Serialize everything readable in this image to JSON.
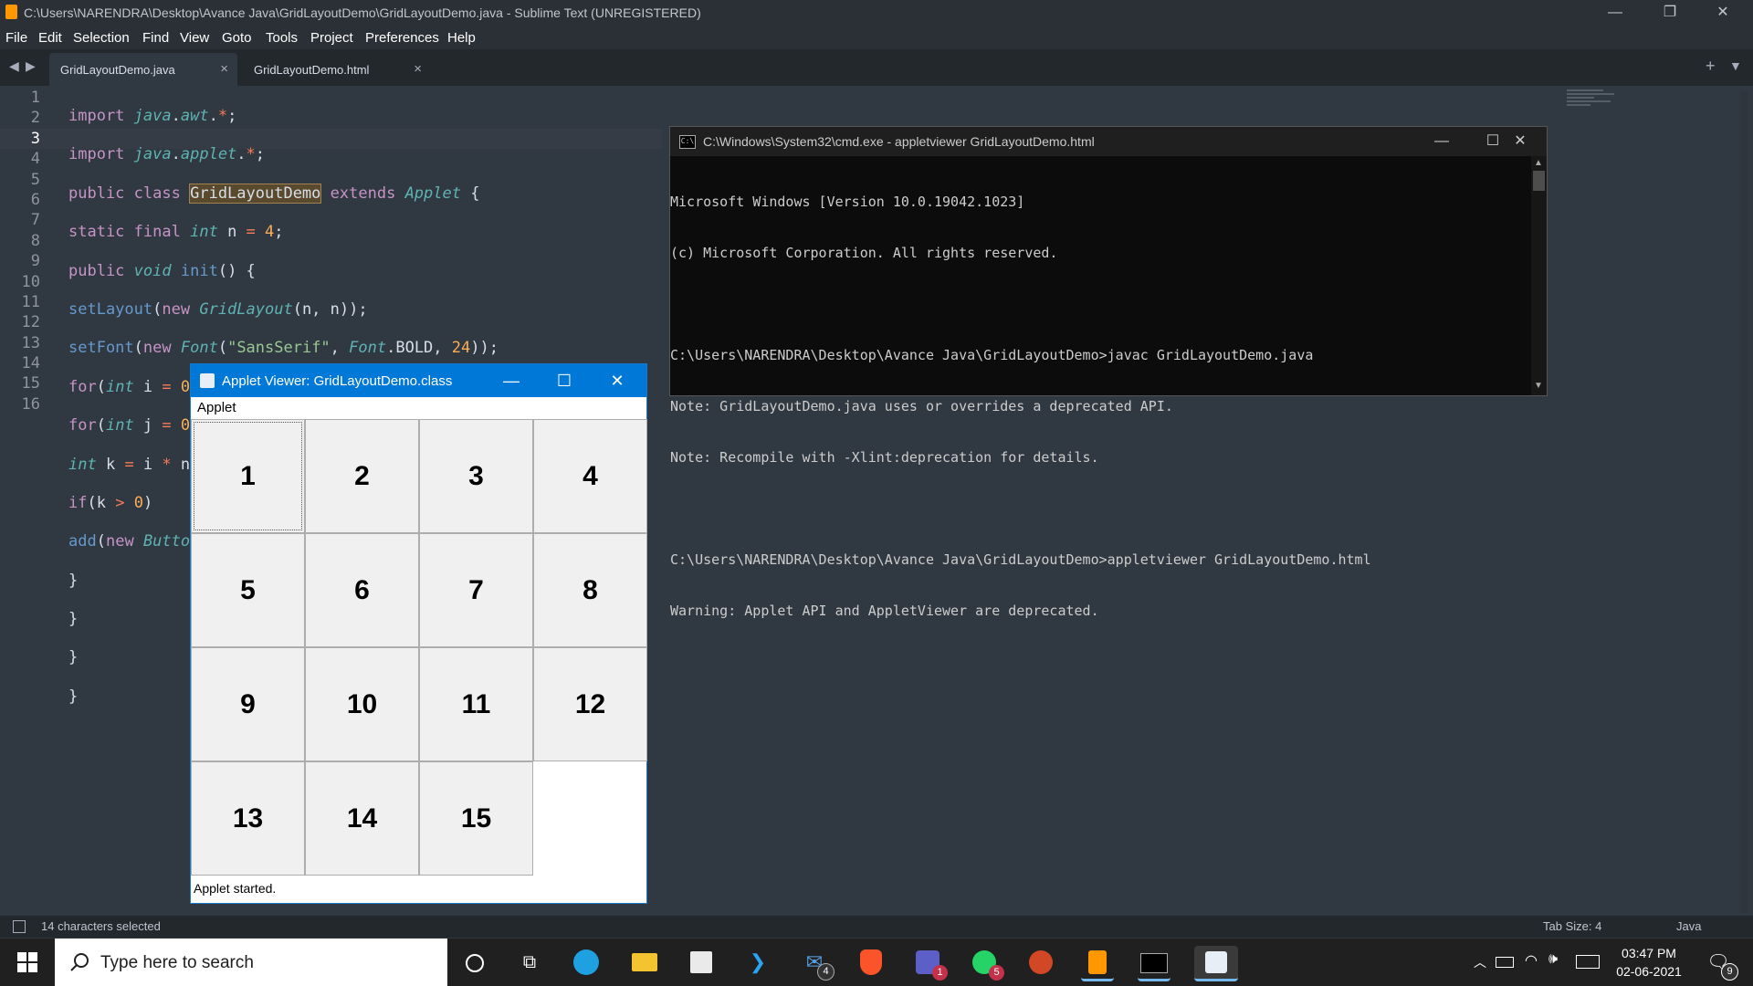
{
  "window": {
    "title": "C:\\Users\\NARENDRA\\Desktop\\Avance Java\\GridLayoutDemo\\GridLayoutDemo.java - Sublime Text (UNREGISTERED)"
  },
  "menu": [
    "File",
    "Edit",
    "Selection",
    "Find",
    "View",
    "Goto",
    "Tools",
    "Project",
    "Preferences",
    "Help"
  ],
  "tabs": [
    {
      "label": "GridLayoutDemo.java",
      "close": "×"
    },
    {
      "label": "GridLayoutDemo.html",
      "close": "×"
    }
  ],
  "editor": {
    "line_numbers": [
      "1",
      "2",
      "3",
      "4",
      "5",
      "6",
      "7",
      "8",
      "9",
      "10",
      "11",
      "12",
      "13",
      "14",
      "15",
      "16"
    ],
    "current_line": 3
  },
  "cmd": {
    "title": "C:\\Windows\\System32\\cmd.exe - appletviewer  GridLayoutDemo.html",
    "icon_text": "C:\\",
    "lines": [
      "Microsoft Windows [Version 10.0.19042.1023]",
      "(c) Microsoft Corporation. All rights reserved.",
      "",
      "C:\\Users\\NARENDRA\\Desktop\\Avance Java\\GridLayoutDemo>javac GridLayoutDemo.java",
      "Note: GridLayoutDemo.java uses or overrides a deprecated API.",
      "Note: Recompile with -Xlint:deprecation for details.",
      "",
      "C:\\Users\\NARENDRA\\Desktop\\Avance Java\\GridLayoutDemo>appletviewer GridLayoutDemo.html",
      "Warning: Applet API and AppletViewer are deprecated."
    ]
  },
  "applet": {
    "title": "Applet Viewer: GridLayoutDemo.class",
    "menu": "Applet",
    "buttons": [
      "1",
      "2",
      "3",
      "4",
      "5",
      "6",
      "7",
      "8",
      "9",
      "10",
      "11",
      "12",
      "13",
      "14",
      "15"
    ],
    "status": "Applet started."
  },
  "statusbar": {
    "selection": "14 characters selected",
    "tab_size": "Tab Size: 4",
    "syntax": "Java"
  },
  "taskbar": {
    "search_placeholder": "Type here to search",
    "badges": {
      "mail": "4",
      "teams": "1",
      "whatsapp": "5",
      "notifications": "9"
    },
    "time": "03:47 PM",
    "date": "02-06-2021"
  },
  "colors": {
    "accent": "#0078d7",
    "sublime_bg": "#303841",
    "cmd_bg": "#0c0c0c"
  }
}
